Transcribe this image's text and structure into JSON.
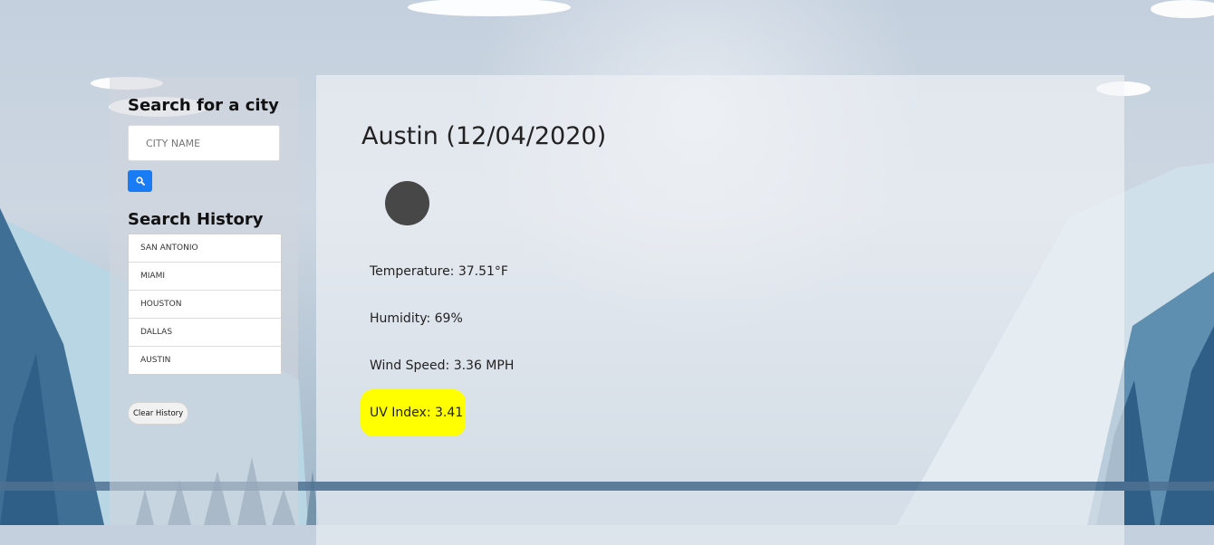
{
  "sidebar": {
    "search_title": "Search for a city",
    "search_placeholder": "CITY NAME",
    "search_button_icon": "search-icon",
    "history_title": "Search History",
    "history": [
      "SAN ANTONIO",
      "MIAMI",
      "HOUSTON",
      "DALLAS",
      "AUSTIN"
    ],
    "clear_label": "Clear History"
  },
  "current": {
    "heading": "Austin (12/04/2020)",
    "weather_icon": "weather-icon",
    "temperature": "Temperature: 37.51°F",
    "humidity": "Humidity: 69%",
    "wind": "Wind Speed: 3.36 MPH",
    "uv": "UV Index: 3.41"
  },
  "colors": {
    "search_button": "#1a7cf5",
    "uv_highlight": "#ffff00",
    "icon_fill": "#474747"
  }
}
